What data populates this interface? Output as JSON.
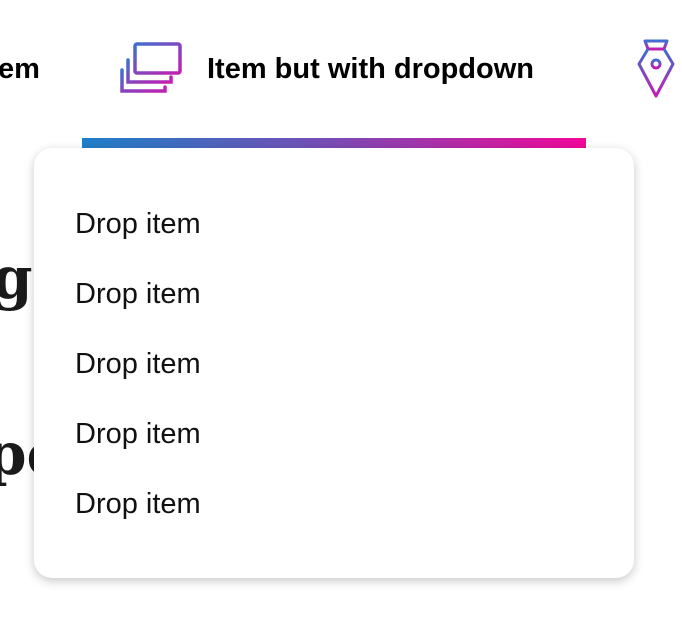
{
  "nav": {
    "items": [
      {
        "label": "em"
      },
      {
        "label": "Item but with dropdown",
        "icon": "stacked-windows-icon"
      },
      {
        "icon": "pen-nib-icon"
      }
    ],
    "gradient": [
      "#1e7fc8",
      "#7b4bb4",
      "#f3079a"
    ]
  },
  "background": {
    "fragments": [
      "gr",
      "pe"
    ]
  },
  "dropdown": {
    "items": [
      {
        "label": "Drop item"
      },
      {
        "label": "Drop item"
      },
      {
        "label": "Drop item"
      },
      {
        "label": "Drop item"
      },
      {
        "label": "Drop item"
      }
    ]
  }
}
